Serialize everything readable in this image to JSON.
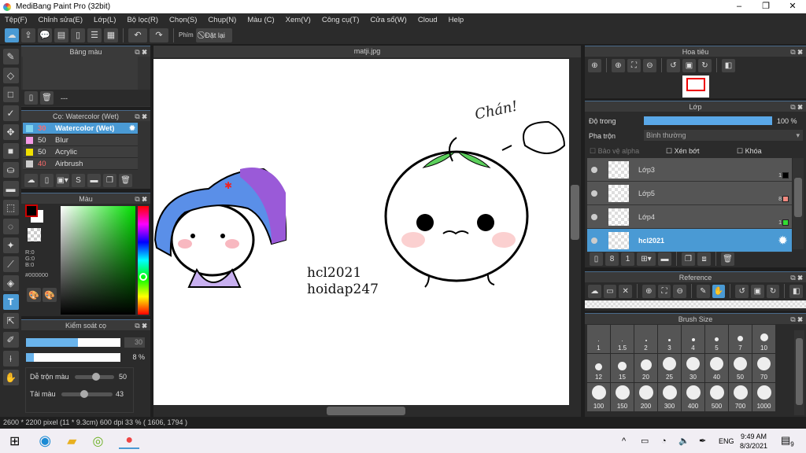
{
  "app": {
    "title": "MediBang Paint Pro (32bit)"
  },
  "menu": [
    "Tệp(F)",
    "Chỉnh sửa(E)",
    "Lớp(L)",
    "Bộ lọc(R)",
    "Chọn(S)",
    "Chụp(N)",
    "Màu (C)",
    "Xem(V)",
    "Công cụ(T)",
    "Cửa sổ(W)",
    "Cloud",
    "Help"
  ],
  "toolbar": {
    "phim_label": "Phím",
    "reset_label": "Đặt lại"
  },
  "palette_panel": {
    "title": "Bảng màu",
    "none_label": "---"
  },
  "brush_panel": {
    "title": "Cọ: Watercolor (Wet)",
    "items": [
      {
        "size": "30",
        "name": "Watercolor (Wet)",
        "color": "#7fd3f0",
        "size_color": "#ff6b6b",
        "selected": true
      },
      {
        "size": "50",
        "name": "Blur",
        "color": "#f59ae6",
        "size_color": "#ddd"
      },
      {
        "size": "50",
        "name": "Acrylic",
        "color": "#f0e000",
        "size_color": "#ddd"
      },
      {
        "size": "40",
        "name": "Airbrush",
        "color": "#cccccc",
        "size_color": "#ff6b6b"
      }
    ]
  },
  "color_panel": {
    "title": "Màu",
    "r": "R:0",
    "g": "G:0",
    "b": "B:0",
    "hex": "#000000"
  },
  "brush_control": {
    "title": "Kiểm soát cọ",
    "size": "30",
    "size_fraction": 0.55,
    "opacity": "8 %",
    "opacity_fraction": 0.08,
    "mix_label": "Dễ trộn màu",
    "mix_value": "50",
    "reload_label": "Tải màu",
    "reload_value": "43"
  },
  "canvas": {
    "tab": "matji.jpg",
    "text_line1": "hcl2021",
    "text_line2": "hoidap247",
    "text_chan": "Chán!"
  },
  "status": {
    "text": "2600 * 2200 pixel   (11 * 9.3cm)  600 dpi  33 %  ( 1606, 1794 )"
  },
  "navigator": {
    "title": "Hoa tiêu"
  },
  "layers": {
    "title": "Lớp",
    "opacity_label": "Độ trong",
    "opacity_value": "100 %",
    "blend_label": "Pha trộn",
    "blend_value": "Bình thường",
    "protect_alpha": "Bảo vệ alpha",
    "clip": "Xén bớt",
    "lock": "Khóa",
    "items": [
      {
        "name": "Lớp3",
        "badge": "1",
        "badge_color": "#000000"
      },
      {
        "name": "Lớp5",
        "badge": "8",
        "badge_color": "#f08a80"
      },
      {
        "name": "Lớp4",
        "badge": "1",
        "badge_color": "#33dd33"
      },
      {
        "name": "hcl2021",
        "selected": true
      }
    ]
  },
  "reference": {
    "title": "Reference"
  },
  "brush_size": {
    "title": "Brush Size",
    "sizes": [
      "1",
      "1.5",
      "2",
      "3",
      "4",
      "5",
      "7",
      "10",
      "12",
      "15",
      "20",
      "25",
      "30",
      "40",
      "50",
      "70",
      "100",
      "150",
      "200",
      "300",
      "400",
      "500",
      "700",
      "1000"
    ]
  },
  "taskbar": {
    "lang": "ENG",
    "time": "9:49 AM",
    "date": "8/3/2021",
    "notifications": "9"
  },
  "colors": {
    "accent": "#4a9ad4",
    "panel": "#333333"
  }
}
